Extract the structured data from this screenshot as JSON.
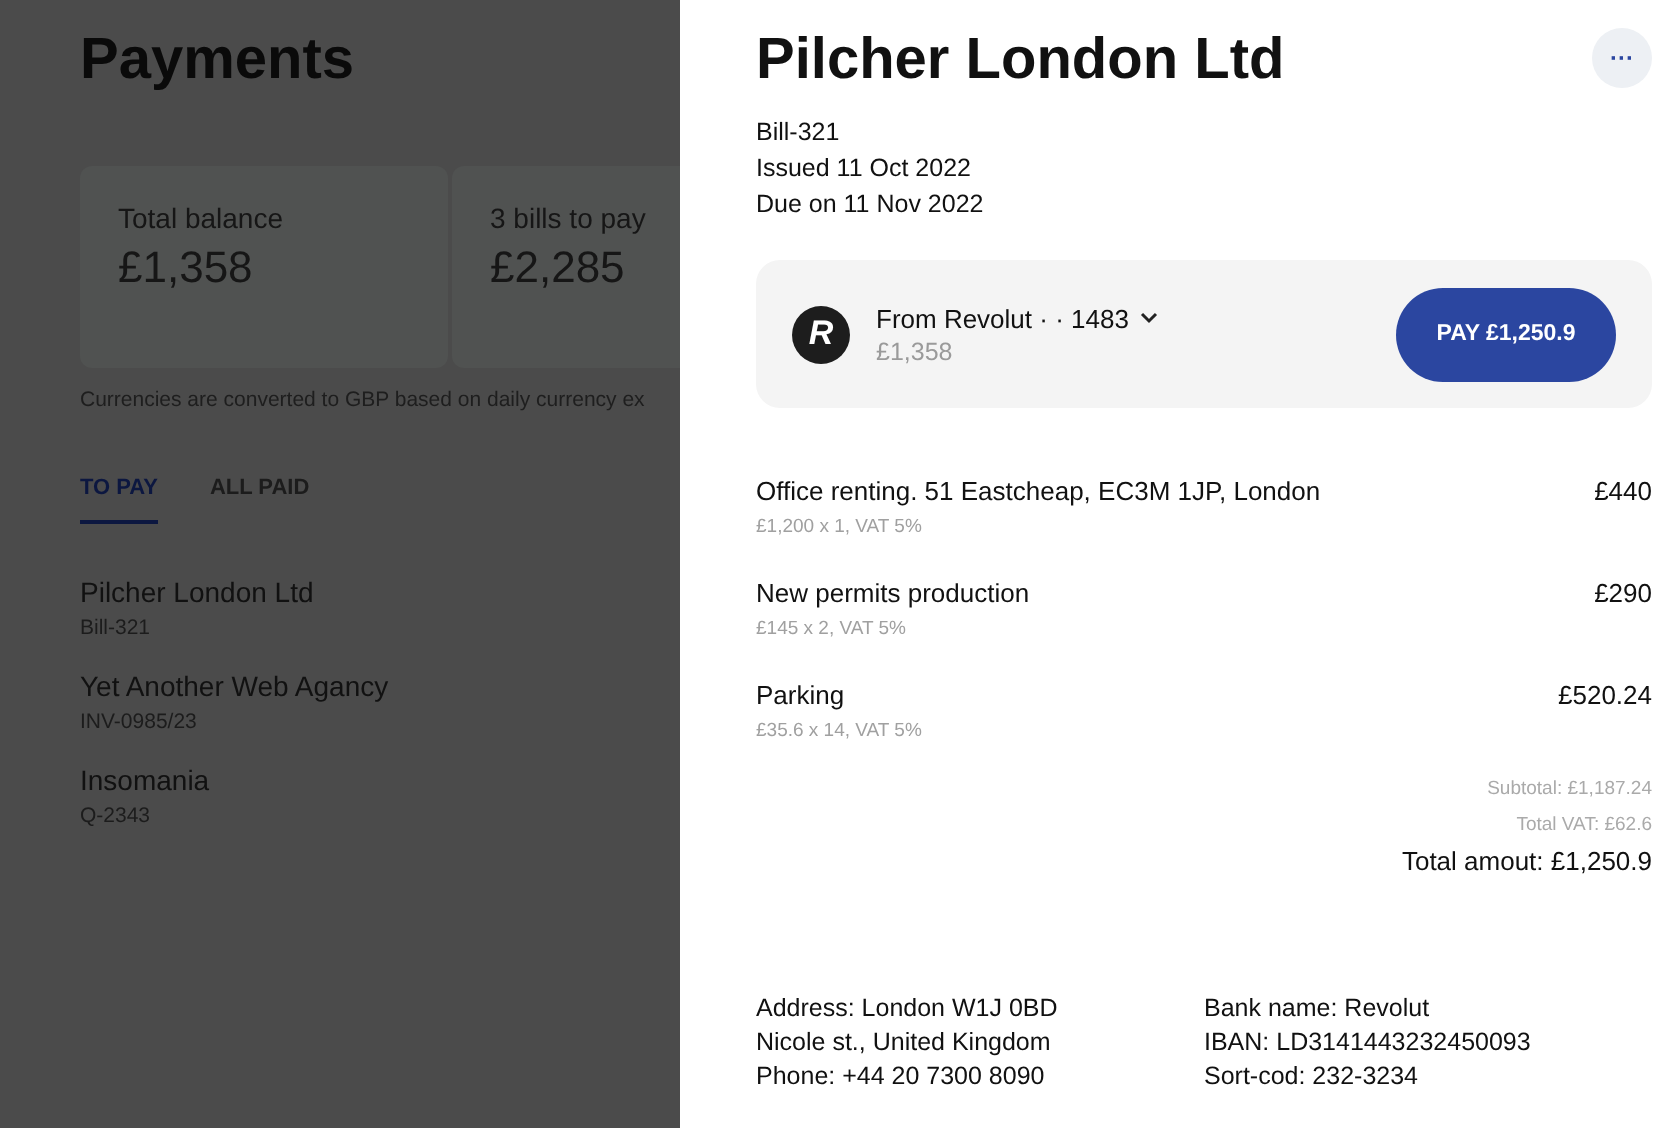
{
  "page": {
    "title": "Payments",
    "summary_cards": [
      {
        "label": "Total balance",
        "value": "£1,358"
      },
      {
        "label": "3 bills to pay",
        "value": "£2,285"
      }
    ],
    "note": "Currencies are converted to GBP based on daily currency ex",
    "tabs": [
      {
        "label": "TO PAY",
        "selected": true
      },
      {
        "label": "ALL PAID",
        "selected": false
      }
    ],
    "bills": [
      {
        "name": "Pilcher London Ltd",
        "ref": "Bill-321"
      },
      {
        "name": "Yet Another Web Agancy",
        "ref": "INV-0985/23"
      },
      {
        "name": "Insomania",
        "ref": "Q-2343"
      }
    ]
  },
  "detail": {
    "title": "Pilcher London Ltd",
    "menu": "···",
    "meta": [
      "Bill-321",
      "Issued 11 Oct 2022",
      "Due on 11 Nov 2022"
    ],
    "payment": {
      "logo_letter": "R",
      "account": "From Revolut · · 1483",
      "balance": "£1,358",
      "button": "PAY £1,250.9"
    },
    "items": [
      {
        "name": "Office renting. 51 Eastcheap, EC3M 1JP, London",
        "detail": "£1,200 x 1, VAT 5%",
        "amount": "£440"
      },
      {
        "name": "New permits production",
        "detail": "£145 x 2, VAT 5%",
        "amount": "£290"
      },
      {
        "name": "Parking",
        "detail": "£35.6 x 14, VAT 5%",
        "amount": "£520.24"
      }
    ],
    "subtotal": "Subtotal: £1,187.24",
    "total_vat": "Total VAT: £62.6",
    "total": "Total amout: £1,250.9",
    "address": [
      "Address: London W1J 0BD",
      "Nicole st., United Kingdom",
      "Phone: +44 20 7300 8090"
    ],
    "bank": [
      "Bank name: Revolut",
      "IBAN: LD3141443232450093",
      "Sort-cod: 232-3234"
    ]
  }
}
